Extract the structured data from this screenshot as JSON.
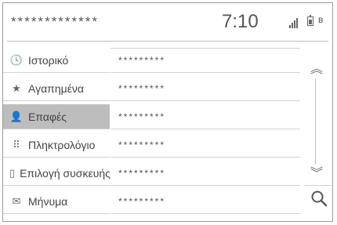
{
  "status_bar": {
    "title": "*************",
    "time": "7:10",
    "signal_icon": "signal-icon",
    "battery_icon": "battery-icon",
    "bluetooth_icon": "bluetooth-icon"
  },
  "sidebar": {
    "items": [
      {
        "label": "Ιστορικό",
        "icon": "clock-icon",
        "glyph": "🕓"
      },
      {
        "label": "Αγαπημένα",
        "icon": "star-icon",
        "glyph": "★"
      },
      {
        "label": "Επαφές",
        "icon": "person-icon",
        "glyph": "👤",
        "active": true
      },
      {
        "label": "Πληκτρολόγιο",
        "icon": "keypad-icon",
        "glyph": "⠿"
      },
      {
        "label": "Επιλογή συσκευής",
        "icon": "device-icon",
        "glyph": "▯"
      },
      {
        "label": "Μήνυμα",
        "icon": "message-icon",
        "glyph": "✉"
      }
    ]
  },
  "contacts": {
    "rows": [
      "*********",
      "*********",
      "*********",
      "*********",
      "*********",
      "*********"
    ]
  },
  "controls": {
    "scroll_up_glyph": "︽",
    "scroll_down_glyph": "︾",
    "search_icon": "search-icon"
  }
}
